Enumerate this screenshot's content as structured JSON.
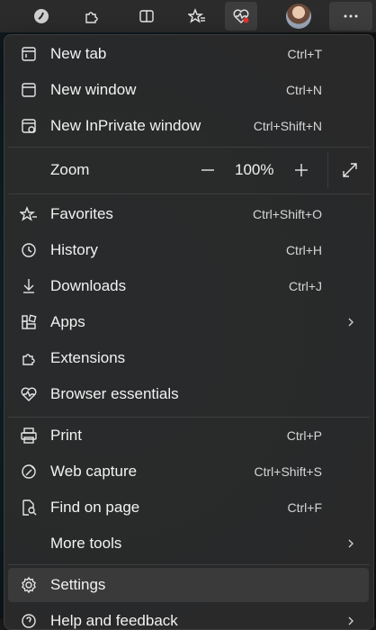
{
  "toolbar": {
    "buttons": [
      {
        "icon": "copilot-icon"
      },
      {
        "icon": "extensions-icon"
      },
      {
        "icon": "split-screen-icon"
      },
      {
        "icon": "favorites-icon"
      },
      {
        "icon": "browser-essentials-icon"
      },
      {
        "icon": "profile-avatar"
      },
      {
        "icon": "more-icon"
      }
    ]
  },
  "menu": {
    "new_tab": {
      "label": "New tab",
      "shortcut": "Ctrl+T"
    },
    "new_window": {
      "label": "New window",
      "shortcut": "Ctrl+N"
    },
    "new_inprivate": {
      "label": "New InPrivate window",
      "shortcut": "Ctrl+Shift+N"
    },
    "zoom": {
      "label": "Zoom",
      "value": "100%",
      "minus": "—",
      "plus": "+"
    },
    "favorites": {
      "label": "Favorites",
      "shortcut": "Ctrl+Shift+O"
    },
    "history": {
      "label": "History",
      "shortcut": "Ctrl+H"
    },
    "downloads": {
      "label": "Downloads",
      "shortcut": "Ctrl+J"
    },
    "apps": {
      "label": "Apps"
    },
    "extensions": {
      "label": "Extensions"
    },
    "browser_essentials": {
      "label": "Browser essentials"
    },
    "print": {
      "label": "Print",
      "shortcut": "Ctrl+P"
    },
    "web_capture": {
      "label": "Web capture",
      "shortcut": "Ctrl+Shift+S"
    },
    "find_on_page": {
      "label": "Find on page",
      "shortcut": "Ctrl+F"
    },
    "more_tools": {
      "label": "More tools"
    },
    "settings": {
      "label": "Settings"
    },
    "help": {
      "label": "Help and feedback"
    }
  },
  "colors": {
    "menu_bg": "#2b2b2b",
    "selected_bg": "#3a3a3a",
    "essentials_badge": "#e0312d"
  }
}
